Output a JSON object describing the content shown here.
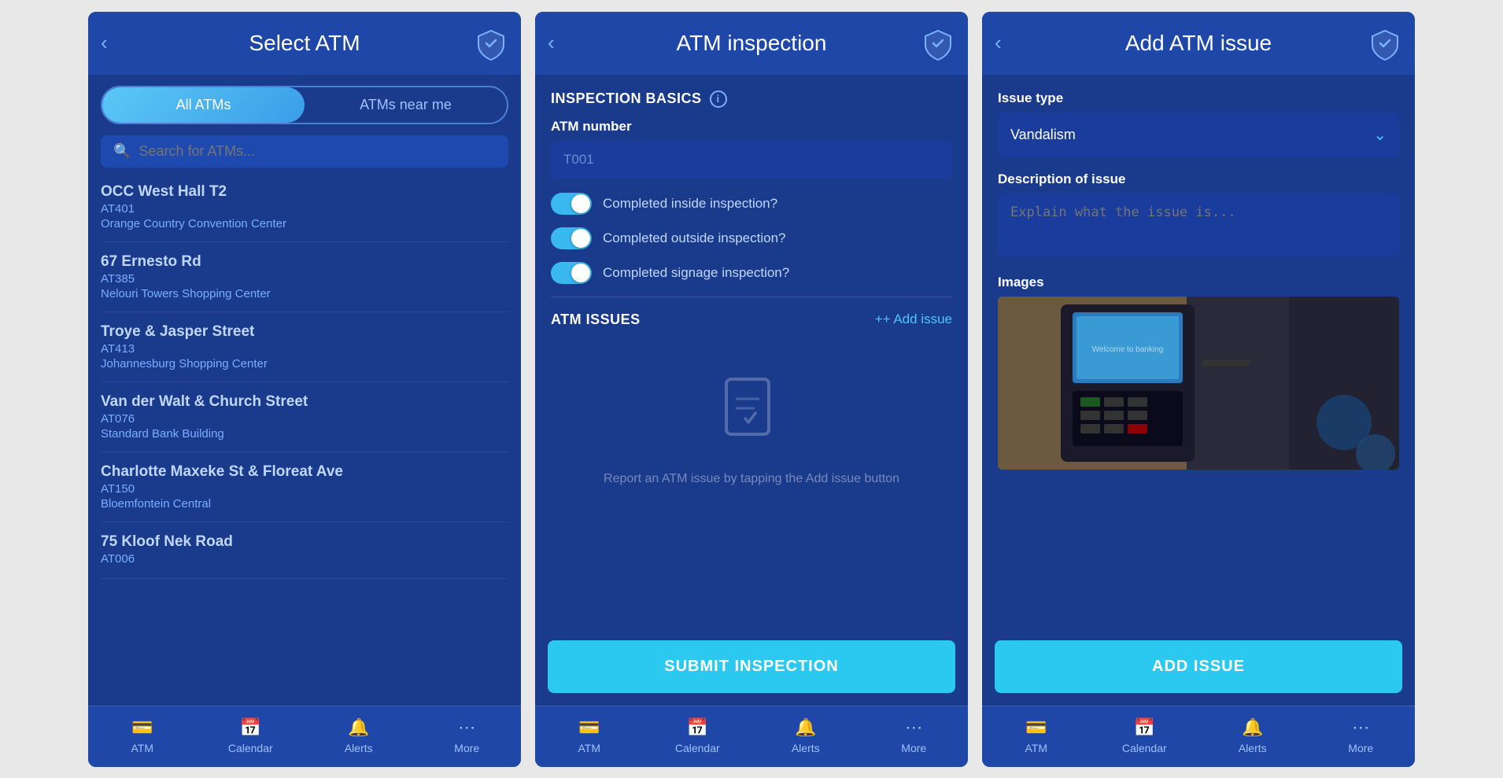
{
  "screen1": {
    "title": "Select ATM",
    "tabs": [
      {
        "label": "All ATMs",
        "active": true
      },
      {
        "label": "ATMs near me",
        "active": false
      }
    ],
    "search_placeholder": "Search for ATMs...",
    "atm_list": [
      {
        "name": "OCC West Hall T2",
        "code": "AT401",
        "location": "Orange Country Convention Center"
      },
      {
        "name": "67 Ernesto Rd",
        "code": "AT385",
        "location": "Nelouri Towers Shopping Center"
      },
      {
        "name": "Troye & Jasper Street",
        "code": "AT413",
        "location": "Johannesburg Shopping Center"
      },
      {
        "name": "Van der Walt & Church Street",
        "code": "AT076",
        "location": "Standard Bank Building"
      },
      {
        "name": "Charlotte Maxeke St & Floreat Ave",
        "code": "AT150",
        "location": "Bloemfontein Central"
      },
      {
        "name": "75 Kloof Nek Road",
        "code": "AT006",
        "location": ""
      }
    ],
    "nav": [
      {
        "label": "ATM",
        "icon": "atm"
      },
      {
        "label": "Calendar",
        "icon": "calendar"
      },
      {
        "label": "Alerts",
        "icon": "bell"
      },
      {
        "label": "More",
        "icon": "more"
      }
    ]
  },
  "screen2": {
    "title": "ATM inspection",
    "section_basics": "INSPECTION BASICS",
    "field_atm_number": "ATM number",
    "atm_number_value": "T001",
    "toggles": [
      {
        "label": "Completed inside inspection?",
        "on": true
      },
      {
        "label": "Completed outside inspection?",
        "on": true
      },
      {
        "label": "Completed signage inspection?",
        "on": true
      }
    ],
    "section_issues": "ATM ISSUES",
    "add_issue_label": "+ Add issue",
    "empty_text": "Report an ATM issue by\ntapping the Add issue button",
    "submit_btn": "SUBMIT INSPECTION",
    "nav": [
      {
        "label": "ATM",
        "icon": "atm"
      },
      {
        "label": "Calendar",
        "icon": "calendar"
      },
      {
        "label": "Alerts",
        "icon": "bell"
      },
      {
        "label": "More",
        "icon": "more"
      }
    ]
  },
  "screen3": {
    "title": "Add ATM issue",
    "issue_type_label": "Issue type",
    "issue_type_value": "Vandalism",
    "description_label": "Description of issue",
    "description_placeholder": "Explain what the issue is...",
    "images_label": "Images",
    "add_issue_btn": "ADD ISSUE",
    "nav": [
      {
        "label": "ATM",
        "icon": "atm"
      },
      {
        "label": "Calendar",
        "icon": "calendar"
      },
      {
        "label": "Alerts",
        "icon": "bell"
      },
      {
        "label": "More",
        "icon": "more"
      }
    ]
  }
}
